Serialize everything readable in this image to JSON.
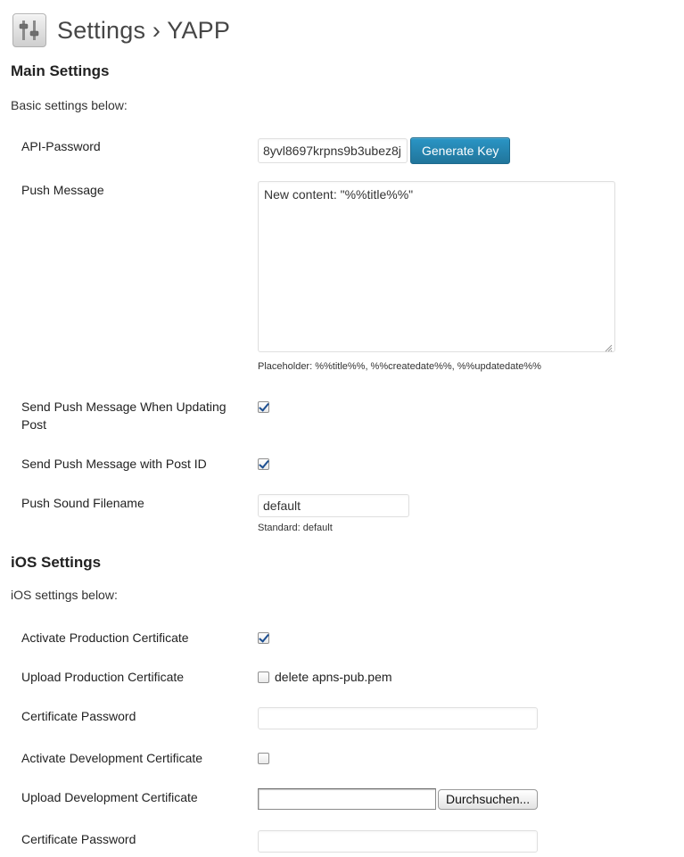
{
  "header": {
    "title": "Settings › YAPP",
    "icon": "settings-sliders-icon"
  },
  "main_settings": {
    "title": "Main Settings",
    "description": "Basic settings below:",
    "api_password": {
      "label": "API-Password",
      "value": "8yvl8697krpns9b3ubez8j",
      "button": "Generate Key"
    },
    "push_message": {
      "label": "Push Message",
      "value": "New content: \"%%title%%\"",
      "note": "Placeholder: %%title%%, %%createdate%%, %%updatedate%%"
    },
    "send_on_update": {
      "label": "Send Push Message When Updating Post",
      "checked": true
    },
    "send_with_post_id": {
      "label": "Send Push Message with Post ID",
      "checked": true
    },
    "push_sound": {
      "label": "Push Sound Filename",
      "value": "default",
      "note": "Standard: default"
    }
  },
  "ios_settings": {
    "title": "iOS Settings",
    "description": "iOS settings below:",
    "activate_production": {
      "label": "Activate Production Certificate",
      "checked": true
    },
    "upload_production": {
      "label": "Upload Production Certificate",
      "delete_label": "delete apns-pub.pem",
      "checked": false
    },
    "production_password": {
      "label": "Certificate Password",
      "value": ""
    },
    "activate_development": {
      "label": "Activate Development Certificate",
      "checked": false
    },
    "upload_development": {
      "label": "Upload Development Certificate",
      "button": "Durchsuchen..."
    },
    "development_password": {
      "label": "Certificate Password",
      "value": ""
    }
  },
  "colors": {
    "primary_button": "#21759b",
    "checkbox_check": "#1d4f91",
    "text": "#222222"
  }
}
